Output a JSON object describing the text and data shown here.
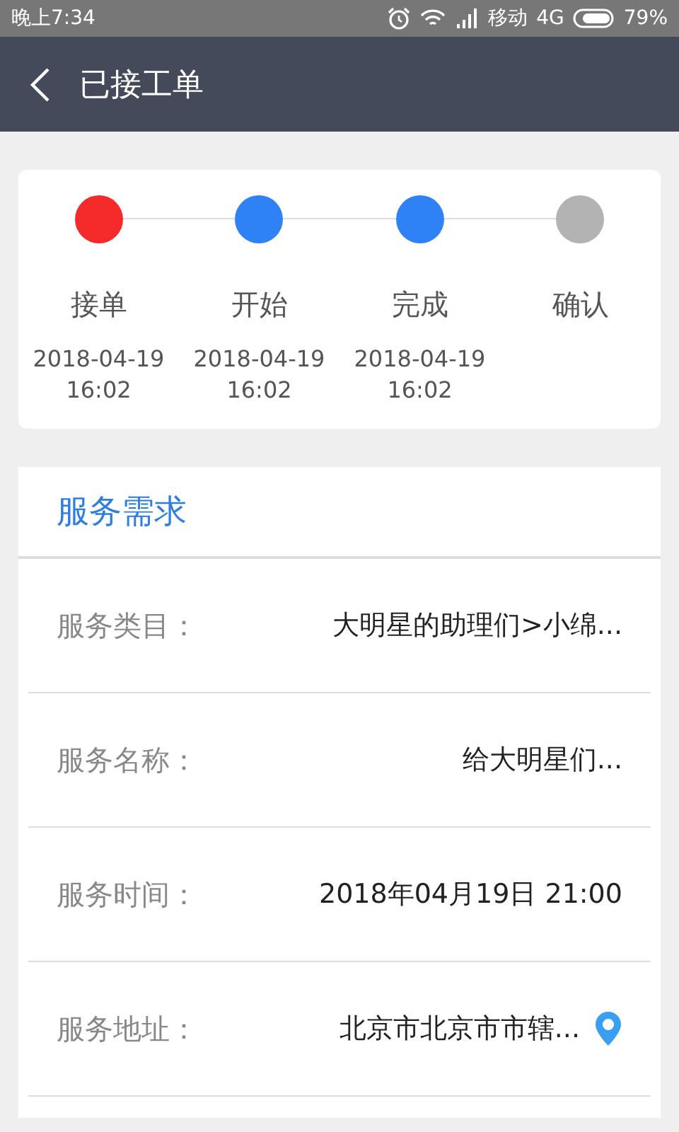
{
  "status_bar": {
    "time": "晚上7:34",
    "carrier": "移动",
    "network": "4G",
    "battery": "79%"
  },
  "header": {
    "title": "已接工单"
  },
  "steps": [
    {
      "label": "接单",
      "date": "2018-04-19",
      "time": "16:02",
      "color": "#f52a2a"
    },
    {
      "label": "开始",
      "date": "2018-04-19",
      "time": "16:02",
      "color": "#2e82f6"
    },
    {
      "label": "完成",
      "date": "2018-04-19",
      "time": "16:02",
      "color": "#2e82f6"
    },
    {
      "label": "确认",
      "color": "#b3b3b3"
    }
  ],
  "section": {
    "title": "服务需求",
    "rows": [
      {
        "kind": "text",
        "label": "服务类目：",
        "value": "大明星的助理们>小绵..."
      },
      {
        "kind": "text",
        "label": "服务名称：",
        "value": "给大明星们..."
      },
      {
        "kind": "text",
        "label": "服务时间：",
        "value": "2018年04月19日 21:00"
      },
      {
        "kind": "location",
        "label": "服务地址：",
        "value": "北京市北京市市辖..."
      }
    ]
  }
}
